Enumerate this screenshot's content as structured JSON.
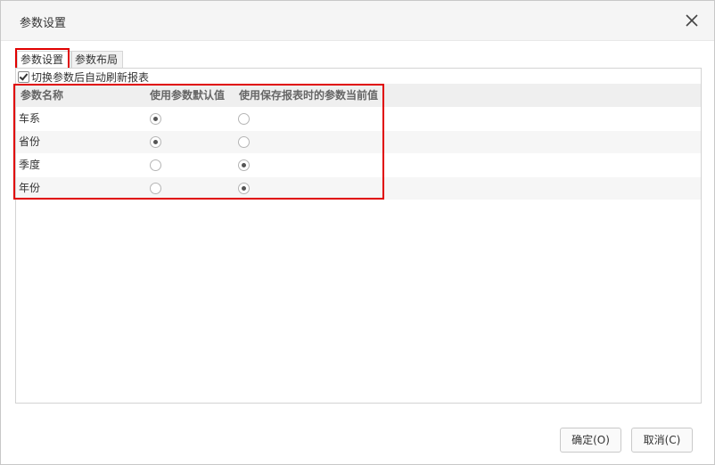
{
  "dialog": {
    "title": "参数设置",
    "close_icon": "close-icon"
  },
  "tabs": [
    {
      "label": "参数设置",
      "active": true
    },
    {
      "label": "参数布局",
      "active": false
    }
  ],
  "refresh_option": {
    "label": "切换参数后自动刷新报表",
    "checked": true
  },
  "table": {
    "headers": [
      "参数名称",
      "使用参数默认值",
      "使用保存报表时的参数当前值"
    ],
    "rows": [
      {
        "name": "车系",
        "selected": "default"
      },
      {
        "name": "省份",
        "selected": "default"
      },
      {
        "name": "季度",
        "selected": "current"
      },
      {
        "name": "年份",
        "selected": "current"
      }
    ]
  },
  "footer": {
    "ok_label": "确定(O)",
    "cancel_label": "取消(C)"
  },
  "colors": {
    "highlight": "#e00000",
    "header_bg": "#efefef",
    "title_bg": "#f5f5f5"
  }
}
